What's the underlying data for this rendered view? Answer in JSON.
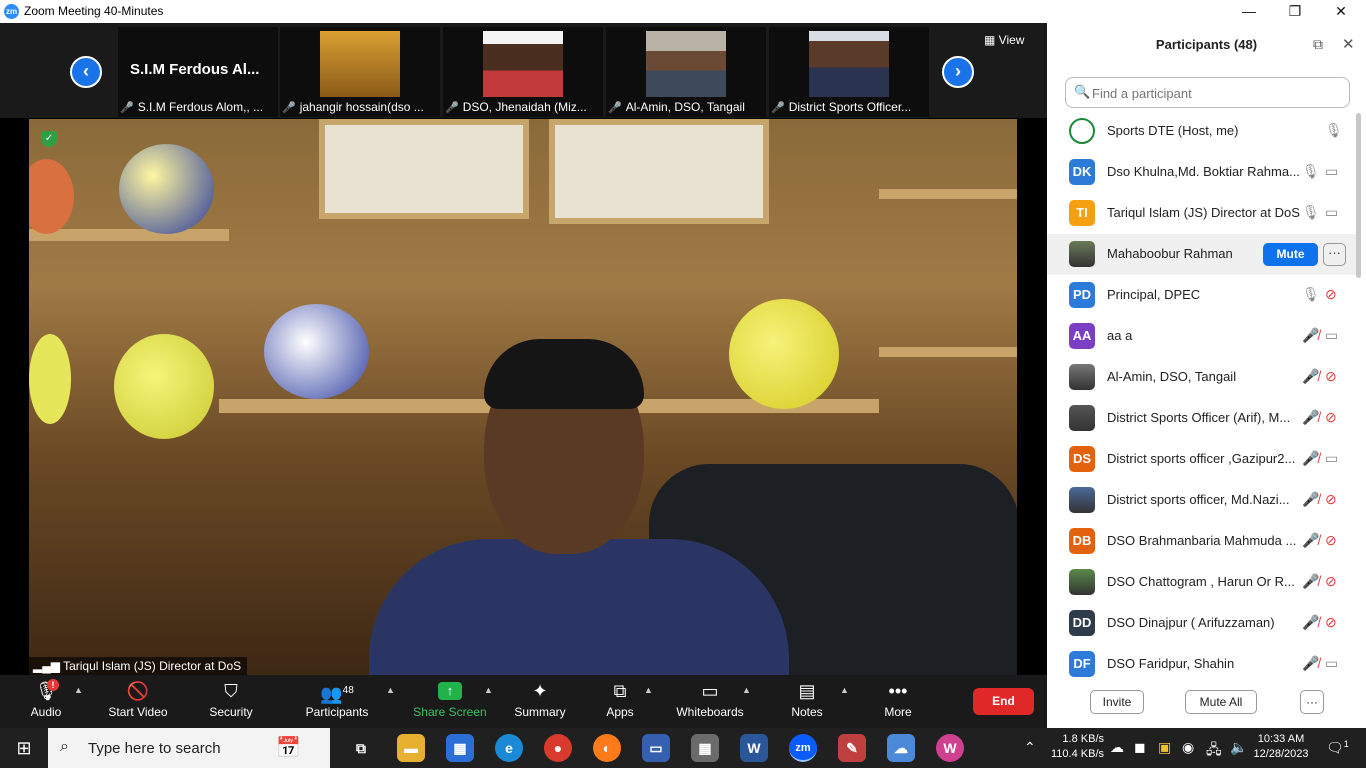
{
  "window": {
    "logo": "zm",
    "title": "Zoom Meeting 40-Minutes",
    "controls": {
      "minimize": "—",
      "restore": "❐",
      "close": "✕"
    }
  },
  "gallery": {
    "prev_icon": "‹",
    "next_icon": "›",
    "view_label": "View",
    "thumbnails": [
      {
        "title": "S.I.M Ferdous Al...",
        "label": "S.I.M Ferdous Alom,, ..."
      },
      {
        "label": "jahangir hossain(dso ..."
      },
      {
        "label": "DSO, Jhenaidah (Miz..."
      },
      {
        "label": "Al-Amin, DSO, Tangail"
      },
      {
        "label": "District Sports Officer..."
      }
    ]
  },
  "main_video": {
    "speaker_label": "Tariqul Islam (JS) Director at DoS"
  },
  "toolbar": {
    "audio": "Audio",
    "audio_badge": "!",
    "start_video": "Start Video",
    "security": "Security",
    "participants": "Participants",
    "participants_count": "48",
    "share_screen": "Share Screen",
    "summary": "Summary",
    "apps": "Apps",
    "whiteboards": "Whiteboards",
    "notes": "Notes",
    "more": "More",
    "end": "End"
  },
  "participants_panel": {
    "title": "Participants (48)",
    "search_placeholder": "Find a participant",
    "mute_label": "Mute",
    "more_label": "···",
    "invite": "Invite",
    "mute_all": "Mute All",
    "footer_more": "···",
    "list": [
      {
        "initials": "",
        "name": "Sports DTE (Host, me)",
        "color": "#ffffff",
        "photo": true,
        "mic": "on",
        "cam": "none"
      },
      {
        "initials": "DK",
        "name": "Dso Khulna,Md. Boktiar Rahma...",
        "color": "#2d7bd8",
        "mic": "on",
        "cam": "on"
      },
      {
        "initials": "TI",
        "name": "Tariqul Islam (JS) Director at DoS",
        "color": "#f5a012",
        "mic": "on",
        "cam": "on"
      },
      {
        "initials": "",
        "name": "Mahaboobur Rahman",
        "color": "#6a7a5a",
        "photo": true,
        "highlight": true
      },
      {
        "initials": "PD",
        "name": "Principal,  DPEC",
        "color": "#2d7bd8",
        "mic": "on",
        "cam": "off"
      },
      {
        "initials": "AA",
        "name": "aa a",
        "color": "#7b3fc4",
        "mic": "off",
        "cam": "on"
      },
      {
        "initials": "",
        "name": "Al-Amin, DSO, Tangail",
        "color": "#777777",
        "photo": true,
        "mic": "off",
        "cam": "off"
      },
      {
        "initials": "",
        "name": "District Sports Officer (Arif), M...",
        "color": "#555555",
        "photo": true,
        "mic": "off",
        "cam": "off"
      },
      {
        "initials": "DS",
        "name": "District sports officer ,Gazipur2...",
        "color": "#e2620e",
        "mic": "off",
        "cam": "on"
      },
      {
        "initials": "",
        "name": "District sports officer, Md.Nazi...",
        "color": "#4a6a9a",
        "photo": true,
        "mic": "off",
        "cam": "off"
      },
      {
        "initials": "DB",
        "name": "DSO Brahmanbaria Mahmuda ...",
        "color": "#e2620e",
        "mic": "off",
        "cam": "off"
      },
      {
        "initials": "",
        "name": "DSO Chattogram , Harun Or R...",
        "color": "#5a8a4a",
        "photo": true,
        "mic": "off",
        "cam": "off"
      },
      {
        "initials": "DD",
        "name": "DSO Dinajpur ( Arifuzzaman)",
        "color": "#2f3a4a",
        "mic": "off",
        "cam": "off"
      },
      {
        "initials": "DF",
        "name": "DSO Faridpur, Shahin",
        "color": "#2d7bd8",
        "mic": "off",
        "cam": "on"
      }
    ]
  },
  "taskbar": {
    "search_text": "Type here to search",
    "net_up": "1.8 KB/s",
    "net_down": "110.4 KB/s",
    "time": "10:33 AM",
    "date": "12/28/2023",
    "notifications": "1"
  }
}
